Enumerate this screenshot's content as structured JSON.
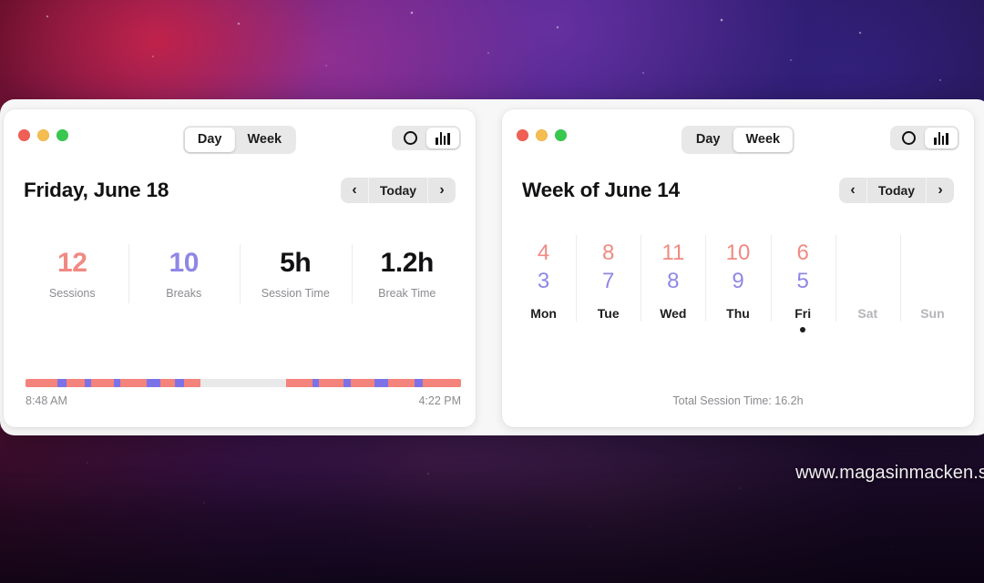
{
  "background": {
    "watermark": "www.magasinmacken.s",
    "accent_red": "#f4837c",
    "accent_purple": "#7b72e8"
  },
  "windows": [
    {
      "id": "day-window",
      "traffic_lights": [
        "close-red",
        "minimize-yellow",
        "zoom-green"
      ],
      "view_toggle": {
        "options": [
          "Day",
          "Week"
        ],
        "selected": "Day"
      },
      "mode_toggle": {
        "options": [
          "timer-ring-icon",
          "bar-chart-icon"
        ],
        "selected": "bar-chart-icon"
      },
      "title": "Friday, June 18",
      "nav": {
        "prev": "‹",
        "today": "Today",
        "next": "›"
      },
      "stats": [
        {
          "value": "12",
          "label": "Sessions",
          "color": "#f08a83"
        },
        {
          "value": "10",
          "label": "Breaks",
          "color": "#8f87e6"
        },
        {
          "value": "5h",
          "label": "Session Time",
          "color": "#111113"
        },
        {
          "value": "1.2h",
          "label": "Break Time",
          "color": "#111113"
        }
      ],
      "timeline": {
        "start_label": "8:48 AM",
        "end_label": "4:22 PM",
        "blocks": [
          {
            "start_pct": 0.0,
            "width_pct": 40.2
          },
          {
            "start_pct": 59.8,
            "width_pct": 40.2
          }
        ],
        "breaks": [
          {
            "start_pct": 7.4,
            "width_pct": 2.0
          },
          {
            "start_pct": 13.6,
            "width_pct": 1.5
          },
          {
            "start_pct": 20.3,
            "width_pct": 1.5
          },
          {
            "start_pct": 27.8,
            "width_pct": 3.1
          },
          {
            "start_pct": 34.4,
            "width_pct": 2.0
          },
          {
            "start_pct": 65.8,
            "width_pct": 1.5
          },
          {
            "start_pct": 73.1,
            "width_pct": 1.5
          },
          {
            "start_pct": 80.2,
            "width_pct": 3.1
          },
          {
            "start_pct": 89.4,
            "width_pct": 1.8
          }
        ]
      }
    },
    {
      "id": "week-window",
      "traffic_lights": [
        "close-red",
        "minimize-yellow",
        "zoom-green"
      ],
      "view_toggle": {
        "options": [
          "Day",
          "Week"
        ],
        "selected": "Week"
      },
      "mode_toggle": {
        "options": [
          "timer-ring-icon",
          "bar-chart-icon"
        ],
        "selected": "bar-chart-icon"
      },
      "title": "Week of June 14",
      "nav": {
        "prev": "‹",
        "today": "Today",
        "next": "›"
      },
      "days": [
        {
          "name": "Mon",
          "sessions": "4",
          "breaks": "3",
          "muted": false,
          "today": false
        },
        {
          "name": "Tue",
          "sessions": "8",
          "breaks": "7",
          "muted": false,
          "today": false
        },
        {
          "name": "Wed",
          "sessions": "11",
          "breaks": "8",
          "muted": false,
          "today": false
        },
        {
          "name": "Thu",
          "sessions": "10",
          "breaks": "9",
          "muted": false,
          "today": false
        },
        {
          "name": "Fri",
          "sessions": "6",
          "breaks": "5",
          "muted": false,
          "today": true
        },
        {
          "name": "Sat",
          "sessions": "",
          "breaks": "",
          "muted": true,
          "today": false
        },
        {
          "name": "Sun",
          "sessions": "",
          "breaks": "",
          "muted": true,
          "today": false
        }
      ],
      "total_label": "Total Session Time: 16.2h"
    }
  ]
}
